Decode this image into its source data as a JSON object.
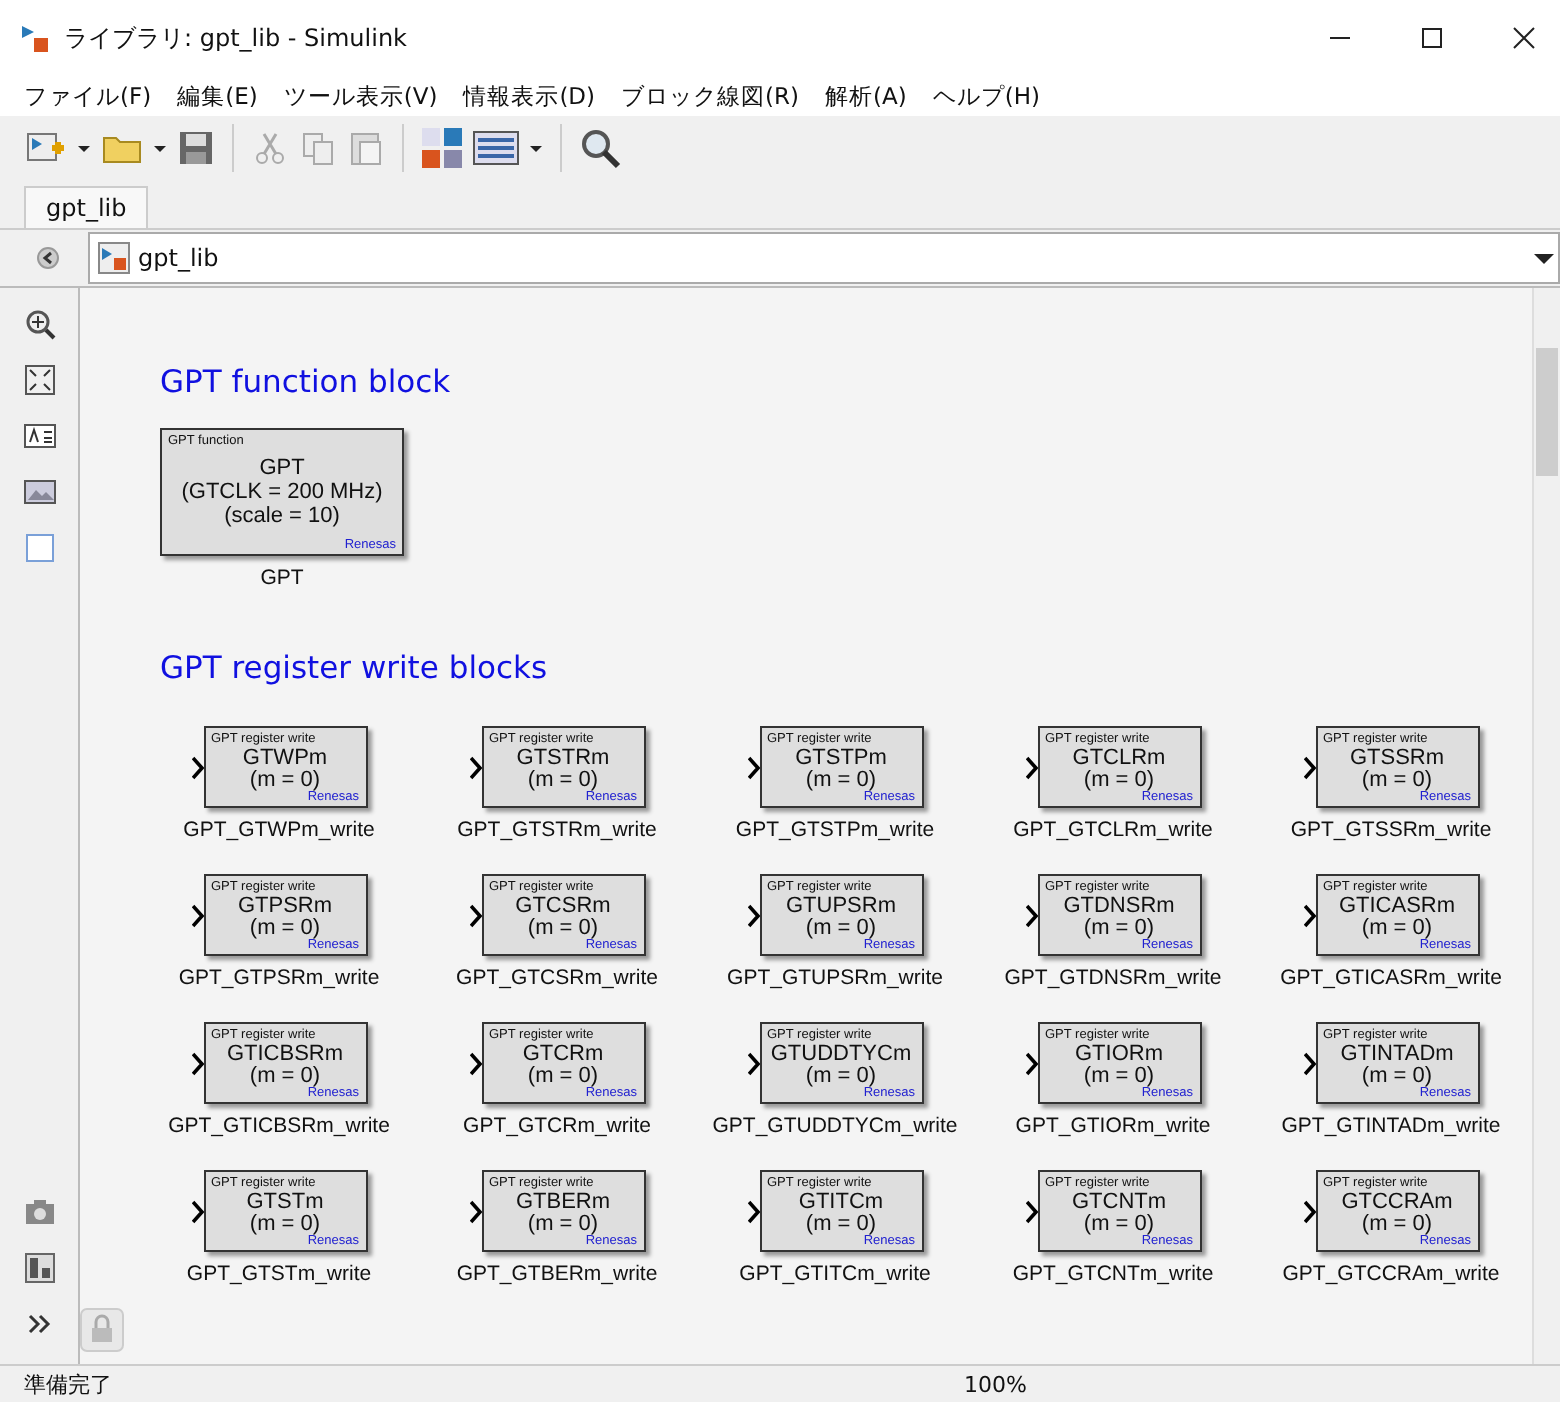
{
  "window": {
    "title": "ライブラリ: gpt_lib - Simulink"
  },
  "menu": [
    "ファイル(F)",
    "編集(E)",
    "ツール表示(V)",
    "情報表示(D)",
    "ブロック線図(R)",
    "解析(A)",
    "ヘルプ(H)"
  ],
  "tabs": [
    {
      "label": "gpt_lib",
      "selected": true
    }
  ],
  "address": {
    "path": "gpt_lib"
  },
  "sections": [
    {
      "heading": "GPT function block",
      "kind": "function",
      "blocks": [
        {
          "header": "GPT function",
          "lines": [
            "GPT",
            "(GTCLK = 200 MHz)",
            "(scale = 10)"
          ],
          "vendor": "Renesas",
          "label": "GPT"
        }
      ]
    },
    {
      "heading": "GPT register write blocks",
      "kind": "write",
      "blocks": [
        {
          "header": "GPT register write",
          "lines": [
            "GTWPm",
            "(m = 0)"
          ],
          "vendor": "Renesas",
          "label": "GPT_GTWPm_write"
        },
        {
          "header": "GPT register write",
          "lines": [
            "GTSTRm",
            "(m = 0)"
          ],
          "vendor": "Renesas",
          "label": "GPT_GTSTRm_write"
        },
        {
          "header": "GPT register write",
          "lines": [
            "GTSTPm",
            "(m = 0)"
          ],
          "vendor": "Renesas",
          "label": "GPT_GTSTPm_write"
        },
        {
          "header": "GPT register write",
          "lines": [
            "GTCLRm",
            "(m = 0)"
          ],
          "vendor": "Renesas",
          "label": "GPT_GTCLRm_write"
        },
        {
          "header": "GPT register write",
          "lines": [
            "GTSSRm",
            "(m = 0)"
          ],
          "vendor": "Renesas",
          "label": "GPT_GTSSRm_write"
        },
        {
          "header": "GPT register write",
          "lines": [
            "GTPSRm",
            "(m = 0)"
          ],
          "vendor": "Renesas",
          "label": "GPT_GTPSRm_write"
        },
        {
          "header": "GPT register write",
          "lines": [
            "GTCSRm",
            "(m = 0)"
          ],
          "vendor": "Renesas",
          "label": "GPT_GTCSRm_write"
        },
        {
          "header": "GPT register write",
          "lines": [
            "GTUPSRm",
            "(m = 0)"
          ],
          "vendor": "Renesas",
          "label": "GPT_GTUPSRm_write"
        },
        {
          "header": "GPT register write",
          "lines": [
            "GTDNSRm",
            "(m = 0)"
          ],
          "vendor": "Renesas",
          "label": "GPT_GTDNSRm_write"
        },
        {
          "header": "GPT register write",
          "lines": [
            "GTICASRm",
            "(m = 0)"
          ],
          "vendor": "Renesas",
          "label": "GPT_GTICASRm_write"
        },
        {
          "header": "GPT register write",
          "lines": [
            "GTICBSRm",
            "(m = 0)"
          ],
          "vendor": "Renesas",
          "label": "GPT_GTICBSRm_write"
        },
        {
          "header": "GPT register write",
          "lines": [
            "GTCRm",
            "(m = 0)"
          ],
          "vendor": "Renesas",
          "label": "GPT_GTCRm_write"
        },
        {
          "header": "GPT register write",
          "lines": [
            "GTUDDTYCm",
            "(m = 0)"
          ],
          "vendor": "Renesas",
          "label": "GPT_GTUDDTYCm_write"
        },
        {
          "header": "GPT register write",
          "lines": [
            "GTIORm",
            "(m = 0)"
          ],
          "vendor": "Renesas",
          "label": "GPT_GTIORm_write"
        },
        {
          "header": "GPT register write",
          "lines": [
            "GTINTADm",
            "(m = 0)"
          ],
          "vendor": "Renesas",
          "label": "GPT_GTINTADm_write"
        },
        {
          "header": "GPT register write",
          "lines": [
            "GTSTm",
            "(m = 0)"
          ],
          "vendor": "Renesas",
          "label": "GPT_GTSTm_write"
        },
        {
          "header": "GPT register write",
          "lines": [
            "GTBERm",
            "(m = 0)"
          ],
          "vendor": "Renesas",
          "label": "GPT_GTBERm_write"
        },
        {
          "header": "GPT register write",
          "lines": [
            "GTITCm",
            "(m = 0)"
          ],
          "vendor": "Renesas",
          "label": "GPT_GTITCm_write"
        },
        {
          "header": "GPT register write",
          "lines": [
            "GTCNTm",
            "(m = 0)"
          ],
          "vendor": "Renesas",
          "label": "GPT_GTCNTm_write"
        },
        {
          "header": "GPT register write",
          "lines": [
            "GTCCRAm",
            "(m = 0)"
          ],
          "vendor": "Renesas",
          "label": "GPT_GTCCRAm_write"
        }
      ]
    }
  ],
  "status_bar": {
    "message": "準備完了",
    "zoom": "100%"
  }
}
